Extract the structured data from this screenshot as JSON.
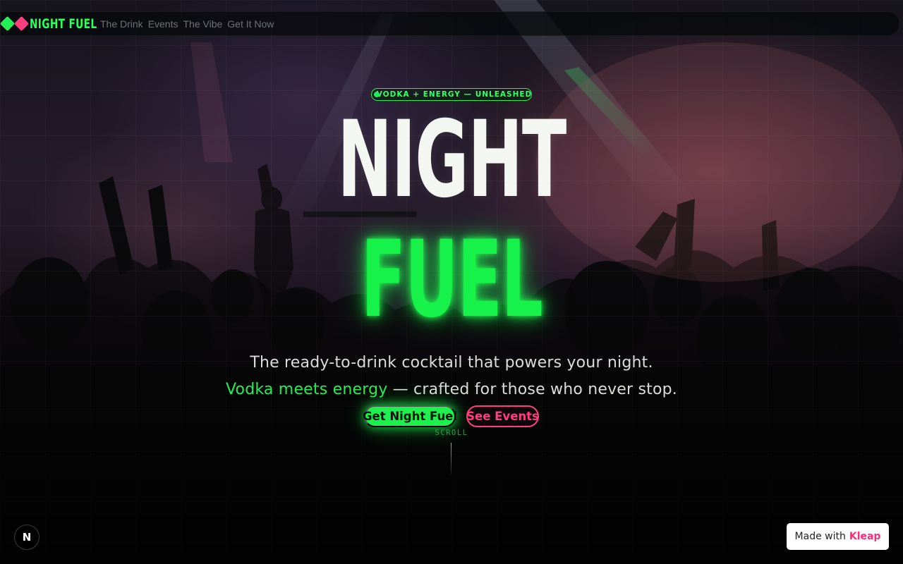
{
  "nav": {
    "logo_text": "NIGHT FUEL",
    "links": [
      "The Drink",
      "Events",
      "The Vibe",
      "Get It Now"
    ]
  },
  "hero": {
    "badge": "VODKA + ENERGY — UNLEASHED",
    "title_line1": "NIGHT",
    "title_line2": "FUEL",
    "subtitle_line1": "The ready-to-drink cocktail that powers your night.",
    "subtitle_line2_accent": "Vodka meets energy",
    "subtitle_line2_rest": " — crafted for those who never stop.",
    "primary_cta": "Get Night Fuel",
    "secondary_cta": "See Events",
    "scroll_label": "SCROLL"
  },
  "corner": {
    "framework_badge": "N",
    "made_with_prefix": "Made with",
    "made_with_brand": "Kleap"
  },
  "colors": {
    "neon_green": "#22ee55",
    "neon_pink": "#ff3d7f",
    "background": "#0a0610"
  },
  "icons": {
    "logo_marks": [
      "green-diamond-icon",
      "pink-diamond-icon"
    ]
  }
}
